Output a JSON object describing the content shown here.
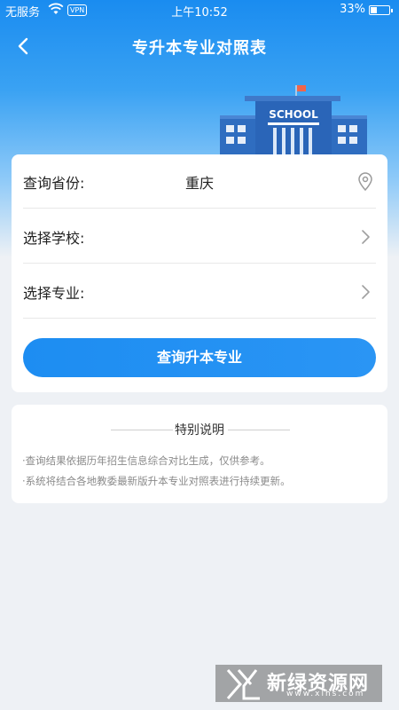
{
  "status_bar": {
    "carrier": "无服务",
    "vpn": "VPN",
    "time": "上午10:52",
    "battery": "33%"
  },
  "nav": {
    "title": "专升本专业对照表"
  },
  "school_sign": "SCHOOL",
  "form": {
    "province_label": "查询省份:",
    "province_value": "重庆",
    "school_label": "选择学校:",
    "major_label": "选择专业:",
    "submit_label": "查询升本专业"
  },
  "notice": {
    "title": "特别说明",
    "lines": [
      "·查询结果依据历年招生信息综合对比生成，仅供参考。",
      "·系统将结合各地教委最新版升本专业对照表进行持续更新。"
    ]
  },
  "watermark": {
    "text": "新绿资源网",
    "url": "www.xlhs.com"
  },
  "colors": {
    "primary": "#1d8df2",
    "background": "#eef1f5"
  }
}
